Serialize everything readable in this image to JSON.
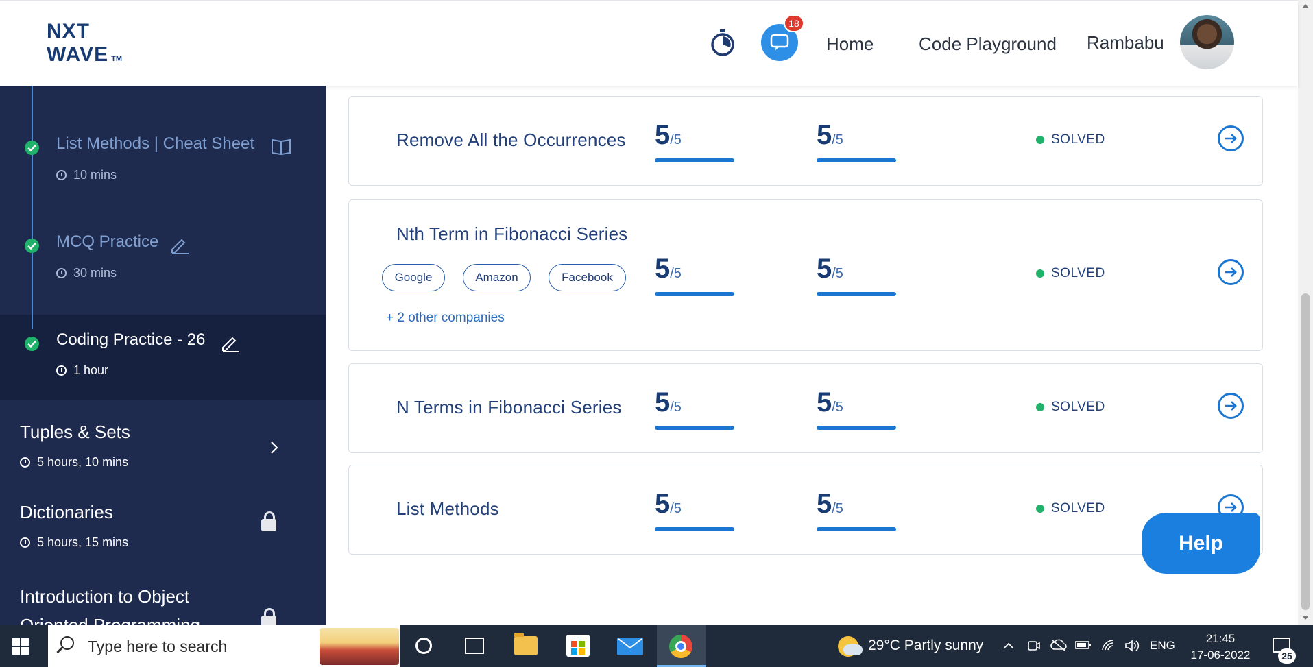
{
  "header": {
    "logo_line1": "NXT",
    "logo_line2": "WAVE",
    "logo_tm": "TM",
    "chat_badge": "18",
    "nav_home": "Home",
    "nav_code_playground": "Code Playground",
    "user_name": "Rambabu"
  },
  "sidebar": {
    "timeline": [
      {
        "title": "List Methods | Cheat Sheet",
        "duration": "10 mins",
        "icon": "book-icon",
        "active": false
      },
      {
        "title": "MCQ Practice",
        "duration": "30 mins",
        "icon": "pencil-icon",
        "active": false
      },
      {
        "title": "Coding Practice - 26",
        "duration": "1 hour",
        "icon": "pencil-icon",
        "active": true
      }
    ],
    "modules": [
      {
        "title": "Tuples & Sets",
        "duration": "5 hours, 10 mins",
        "state": "chevron-right-icon"
      },
      {
        "title": "Dictionaries",
        "duration": "5 hours, 15 mins",
        "state": "lock-icon"
      },
      {
        "title": "Introduction to Object Oriented Programming",
        "state": "lock-icon"
      }
    ]
  },
  "questions": [
    {
      "title": "Remove All the Occurrences",
      "score1": "5",
      "total1": "/5",
      "score2": "5",
      "total2": "/5",
      "status": "SOLVED"
    },
    {
      "title": "Nth Term in Fibonacci Series",
      "score1": "5",
      "total1": "/5",
      "score2": "5",
      "total2": "/5",
      "status": "SOLVED",
      "tags": [
        "Google",
        "Amazon",
        "Facebook"
      ],
      "other_companies": "+ 2 other companies"
    },
    {
      "title": "N Terms in Fibonacci Series",
      "score1": "5",
      "total1": "/5",
      "score2": "5",
      "total2": "/5",
      "status": "SOLVED"
    },
    {
      "title": "List Methods",
      "score1": "5",
      "total1": "/5",
      "score2": "5",
      "total2": "/5",
      "status": "SOLVED"
    }
  ],
  "help_label": "Help",
  "taskbar": {
    "search_placeholder": "Type here to search",
    "weather": "29°C  Partly sunny",
    "language": "ENG",
    "time": "21:45",
    "date": "17-06-2022",
    "notification_count": "25"
  },
  "colors": {
    "sidebar_bg": "#1e2a4e",
    "sidebar_active_bg": "#16203f",
    "accent_blue": "#1b76d2",
    "solved_green": "#20b26b",
    "title_navy": "#183b74"
  }
}
